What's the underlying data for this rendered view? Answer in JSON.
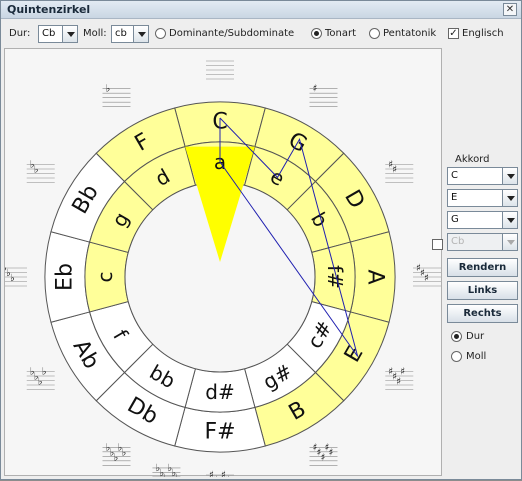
{
  "window": {
    "title": "Quintenzirkel",
    "close_symbol": "✕"
  },
  "toolbar": {
    "dur_label": "Dur:",
    "dur_value": "Cb",
    "moll_label": "Moll:",
    "moll_value": "cb",
    "options": [
      {
        "label": "Dominante/Subdominate",
        "type": "radio",
        "selected": false
      },
      {
        "label": "Tonart",
        "type": "radio",
        "selected": true
      },
      {
        "label": "Pentatonik",
        "type": "radio",
        "selected": false
      },
      {
        "label": "Englisch",
        "type": "checkbox",
        "checked": true
      }
    ]
  },
  "circle": {
    "major_keys": [
      "C",
      "G",
      "D",
      "A",
      "E",
      "B",
      "F#",
      "Db",
      "Ab",
      "Eb",
      "Bb",
      "F"
    ],
    "minor_keys": [
      "a",
      "e",
      "b",
      "f#",
      "c#",
      "g#",
      "d#",
      "bb",
      "f",
      "c",
      "g",
      "d"
    ],
    "outer_highlight_indices": [
      0,
      1,
      2,
      3,
      4,
      5,
      11
    ],
    "inner_highlight_indices": [
      0,
      1,
      2,
      3,
      9,
      10,
      11
    ],
    "highlight_color": "#ffff99",
    "pointer_color": "#ffff00",
    "chord_line_color": "#2020b0",
    "chord_notes_on_circle": [
      "C",
      "E",
      "G"
    ],
    "sharp_counts": [
      0,
      1,
      2,
      3,
      4,
      5,
      6
    ],
    "flat_counts": [
      5,
      4,
      3,
      2,
      1
    ]
  },
  "chord_panel": {
    "title": "Akkord",
    "selects": [
      "C",
      "E",
      "G"
    ],
    "extra_select": "Cb",
    "extra_enabled": false,
    "buttons": [
      "Rendern",
      "Links",
      "Rechts"
    ],
    "mode_options": [
      {
        "label": "Dur",
        "selected": true
      },
      {
        "label": "Moll",
        "selected": false
      }
    ]
  }
}
